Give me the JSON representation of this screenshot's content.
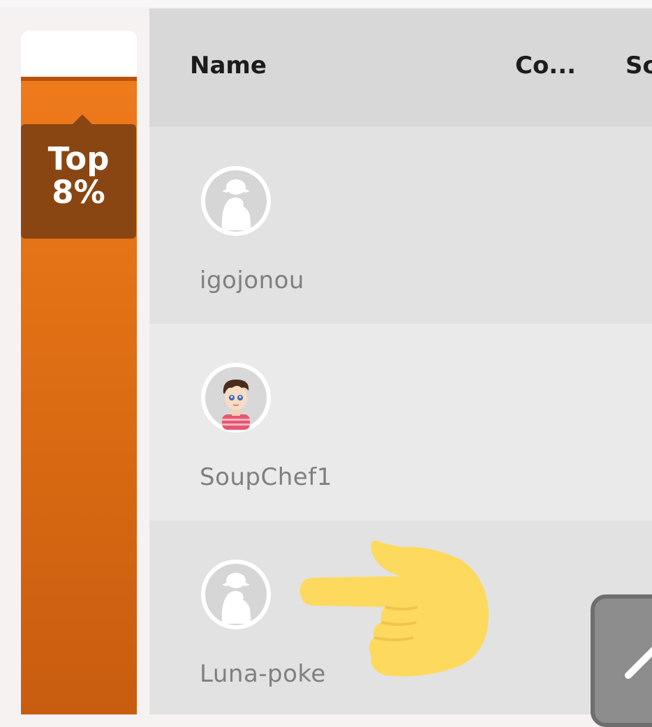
{
  "rank_badge": {
    "line1": "Top",
    "line2": "8%"
  },
  "rank_progress_percent": 8,
  "table": {
    "columns": [
      "Name",
      "Co...",
      "Sc"
    ],
    "rows": [
      {
        "username": "igojonou",
        "avatar": "default-avatar"
      },
      {
        "username": "SoupChef1",
        "avatar": "cartoon-avatar"
      },
      {
        "username": "Luna-poke",
        "avatar": "default-avatar"
      }
    ]
  },
  "icons": {
    "pointer": "pointing-hand-icon",
    "edit": "pencil-icon"
  },
  "colors": {
    "rail_orange": "#e06f14",
    "badge_brown": "#8a4612",
    "header_gray": "#d9d8d8",
    "hand_yellow": "#fdd95e"
  }
}
